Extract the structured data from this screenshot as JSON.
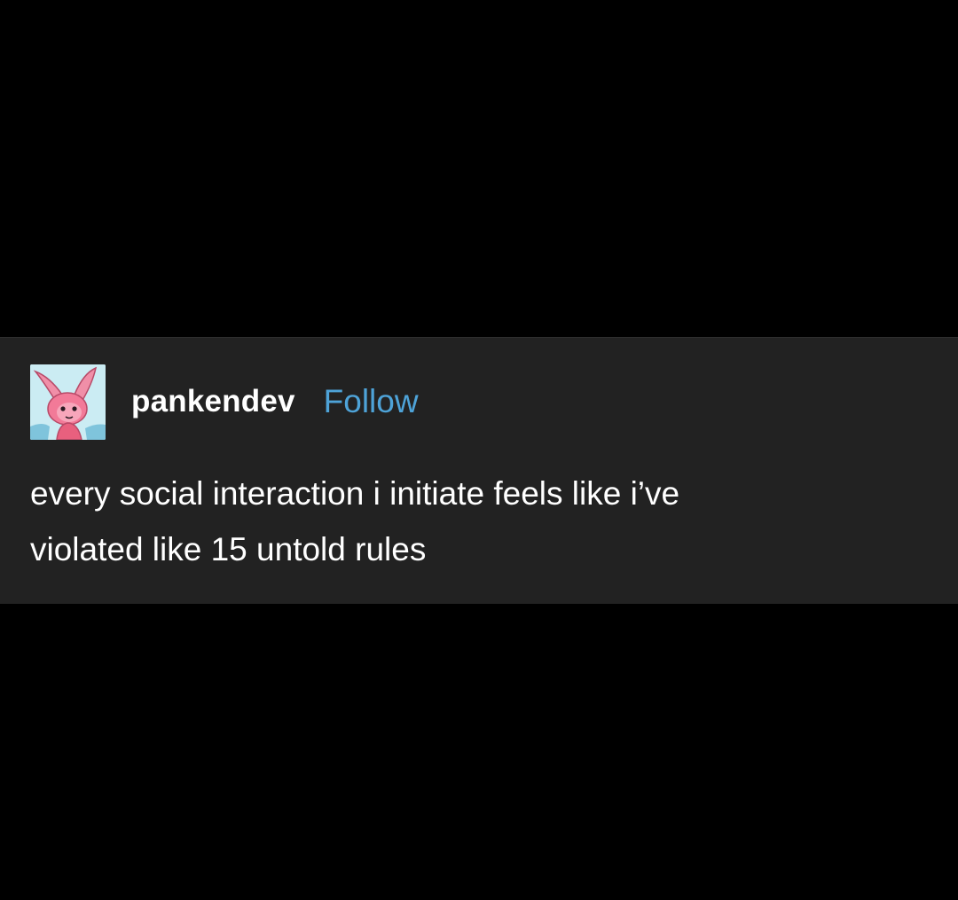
{
  "post": {
    "username": "pankendev",
    "follow_label": "Follow",
    "text_line_1": "every social interaction i initiate feels like i’ve",
    "text_line_2": "violated like 15 untold rules"
  },
  "colors": {
    "background": "#000000",
    "card": "#222222",
    "follow_link": "#4ea3d8",
    "text": "#ffffff"
  },
  "icons": {
    "avatar": "pink-rabbit-character-avatar"
  }
}
